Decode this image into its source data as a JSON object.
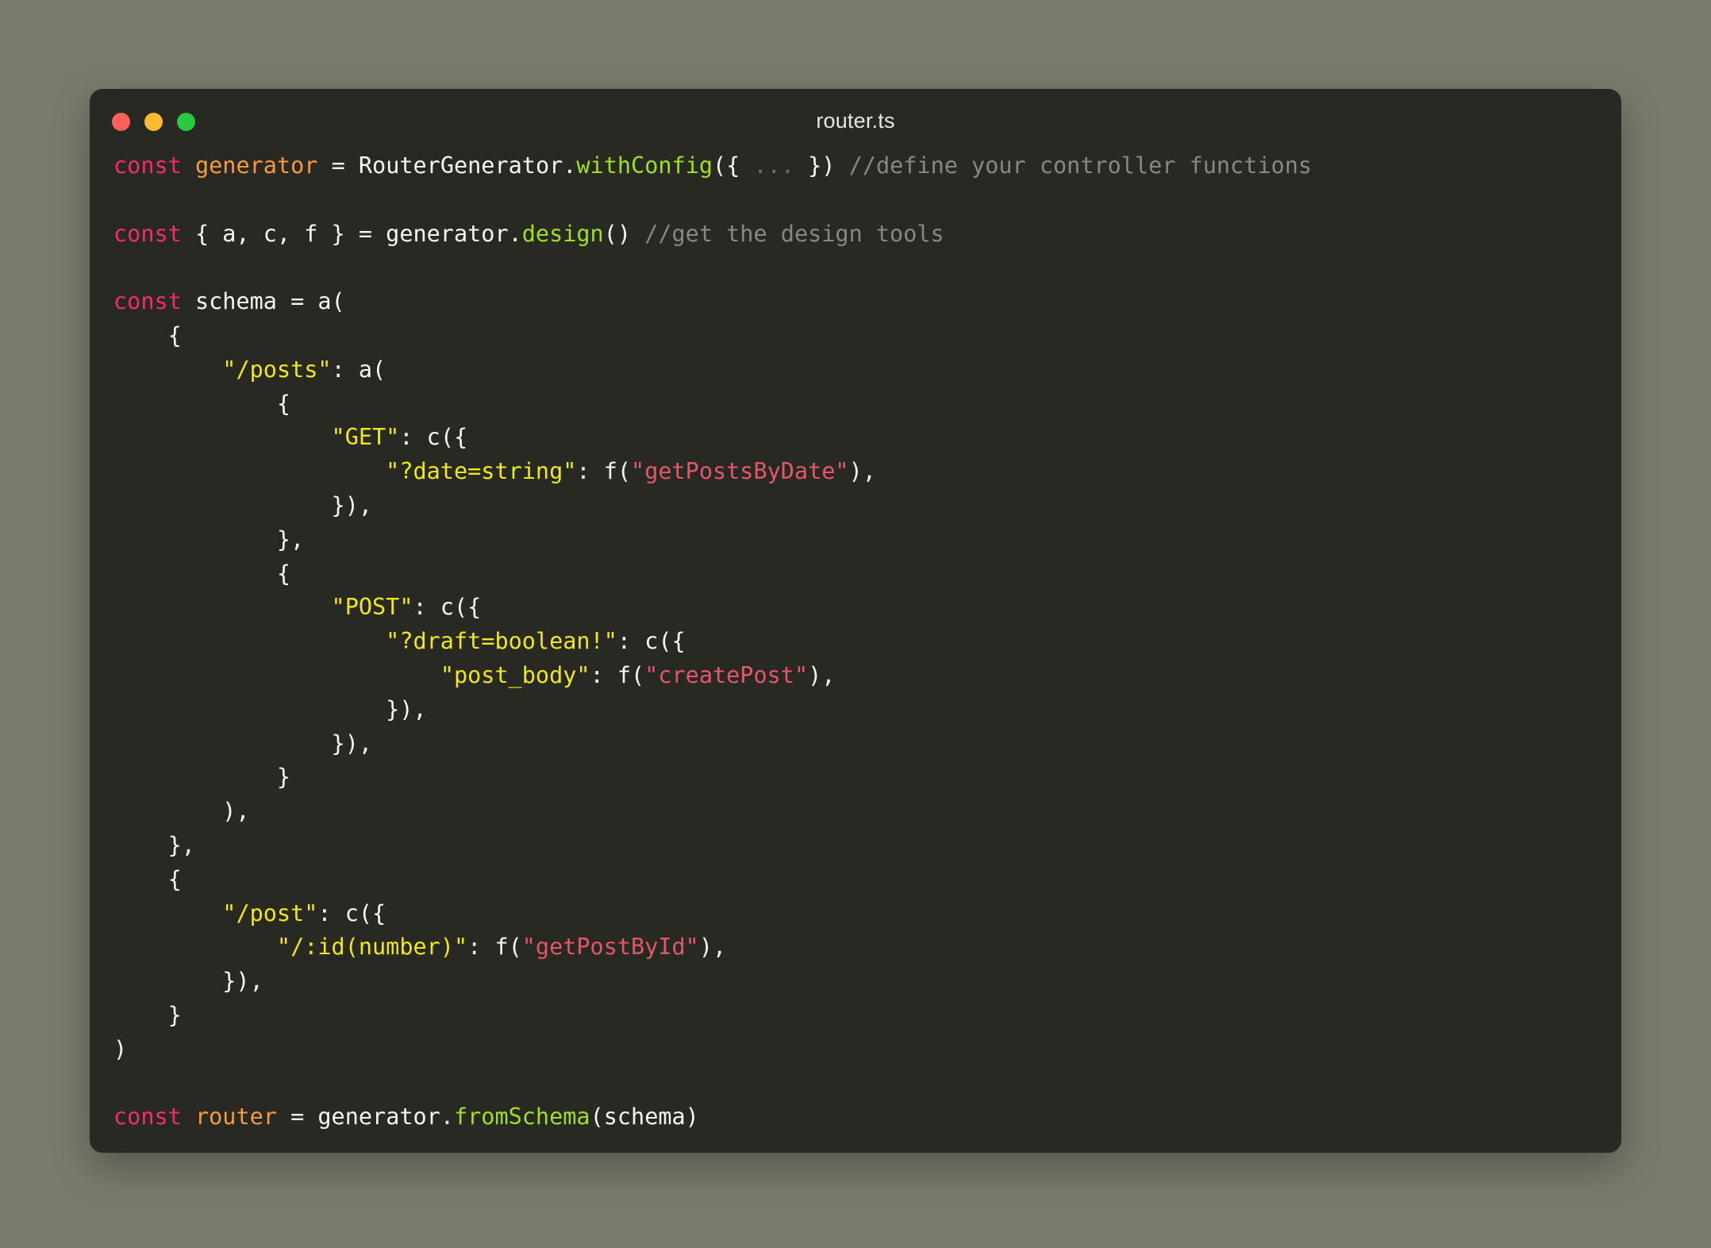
{
  "window": {
    "title": "router.ts",
    "traffic_lights": [
      {
        "name": "close-button",
        "color": "#fe5f57"
      },
      {
        "name": "minimize-button",
        "color": "#febc2e"
      },
      {
        "name": "maximize-button",
        "color": "#28c840"
      }
    ]
  },
  "theme": {
    "background": "#7a7a6e",
    "window_background": "#282923",
    "keyword": "#f42c6d",
    "variable": "#f99a3c",
    "function": "#a0e022",
    "key": "#f2e718",
    "string": "#e5566b",
    "comment": "#88887f",
    "plain": "#f7f7f2"
  },
  "code": {
    "language": "typescript",
    "filename": "router.ts",
    "plain_text": "const generator = RouterGenerator.withConfig({ ... }) //define your controller functions\n\nconst { a, c, f } = generator.design() //get the design tools\n\nconst schema = a(\n    {\n        \"/posts\": a(\n            {\n                \"GET\": c({\n                    \"?date=string\": f(\"getPostsByDate\"),\n                }),\n            },\n            {\n                \"POST\": c({\n                    \"?draft=boolean!\": c({\n                        \"post_body\": f(\"createPost\"),\n                    }),\n                }),\n            }\n        ),\n    },\n    {\n        \"/post\": c({\n            \"/:id(number)\": f(\"getPostById\"),\n        }),\n    }\n)\n\nconst router = generator.fromSchema(schema)",
    "lines": [
      [
        {
          "t": "kw",
          "v": "const"
        },
        {
          "t": "plain",
          "v": " "
        },
        {
          "t": "var",
          "v": "generator"
        },
        {
          "t": "plain",
          "v": " = RouterGenerator."
        },
        {
          "t": "fn",
          "v": "withConfig"
        },
        {
          "t": "plain",
          "v": "({ "
        },
        {
          "t": "dim",
          "v": "..."
        },
        {
          "t": "plain",
          "v": " }) "
        },
        {
          "t": "comment",
          "v": "//define your controller functions"
        }
      ],
      [],
      [
        {
          "t": "kw",
          "v": "const"
        },
        {
          "t": "plain",
          "v": " { a, c, f } = generator."
        },
        {
          "t": "fn",
          "v": "design"
        },
        {
          "t": "plain",
          "v": "() "
        },
        {
          "t": "comment",
          "v": "//get the design tools"
        }
      ],
      [],
      [
        {
          "t": "kw",
          "v": "const"
        },
        {
          "t": "plain",
          "v": " schema = a("
        }
      ],
      [
        {
          "t": "plain",
          "v": "    {"
        }
      ],
      [
        {
          "t": "plain",
          "v": "        "
        },
        {
          "t": "key",
          "v": "\"/posts\""
        },
        {
          "t": "plain",
          "v": ": a("
        }
      ],
      [
        {
          "t": "plain",
          "v": "            {"
        }
      ],
      [
        {
          "t": "plain",
          "v": "                "
        },
        {
          "t": "key",
          "v": "\"GET\""
        },
        {
          "t": "plain",
          "v": ": c({"
        }
      ],
      [
        {
          "t": "plain",
          "v": "                    "
        },
        {
          "t": "key",
          "v": "\"?date=string\""
        },
        {
          "t": "plain",
          "v": ": f("
        },
        {
          "t": "str",
          "v": "\"getPostsByDate\""
        },
        {
          "t": "plain",
          "v": "),"
        }
      ],
      [
        {
          "t": "plain",
          "v": "                }),"
        }
      ],
      [
        {
          "t": "plain",
          "v": "            },"
        }
      ],
      [
        {
          "t": "plain",
          "v": "            {"
        }
      ],
      [
        {
          "t": "plain",
          "v": "                "
        },
        {
          "t": "key",
          "v": "\"POST\""
        },
        {
          "t": "plain",
          "v": ": c({"
        }
      ],
      [
        {
          "t": "plain",
          "v": "                    "
        },
        {
          "t": "key",
          "v": "\"?draft=boolean!\""
        },
        {
          "t": "plain",
          "v": ": c({"
        }
      ],
      [
        {
          "t": "plain",
          "v": "                        "
        },
        {
          "t": "key",
          "v": "\"post_body\""
        },
        {
          "t": "plain",
          "v": ": f("
        },
        {
          "t": "str",
          "v": "\"createPost\""
        },
        {
          "t": "plain",
          "v": "),"
        }
      ],
      [
        {
          "t": "plain",
          "v": "                    }),"
        }
      ],
      [
        {
          "t": "plain",
          "v": "                }),"
        }
      ],
      [
        {
          "t": "plain",
          "v": "            }"
        }
      ],
      [
        {
          "t": "plain",
          "v": "        ),"
        }
      ],
      [
        {
          "t": "plain",
          "v": "    },"
        }
      ],
      [
        {
          "t": "plain",
          "v": "    {"
        }
      ],
      [
        {
          "t": "plain",
          "v": "        "
        },
        {
          "t": "key",
          "v": "\"/post\""
        },
        {
          "t": "plain",
          "v": ": c({"
        }
      ],
      [
        {
          "t": "plain",
          "v": "            "
        },
        {
          "t": "key",
          "v": "\"/:id(number)\""
        },
        {
          "t": "plain",
          "v": ": f("
        },
        {
          "t": "str",
          "v": "\"getPostById\""
        },
        {
          "t": "plain",
          "v": "),"
        }
      ],
      [
        {
          "t": "plain",
          "v": "        }),"
        }
      ],
      [
        {
          "t": "plain",
          "v": "    }"
        }
      ],
      [
        {
          "t": "plain",
          "v": ")"
        }
      ],
      [],
      [
        {
          "t": "kw",
          "v": "const"
        },
        {
          "t": "plain",
          "v": " "
        },
        {
          "t": "var",
          "v": "router"
        },
        {
          "t": "plain",
          "v": " = generator."
        },
        {
          "t": "fn",
          "v": "fromSchema"
        },
        {
          "t": "plain",
          "v": "(schema)"
        }
      ]
    ]
  }
}
